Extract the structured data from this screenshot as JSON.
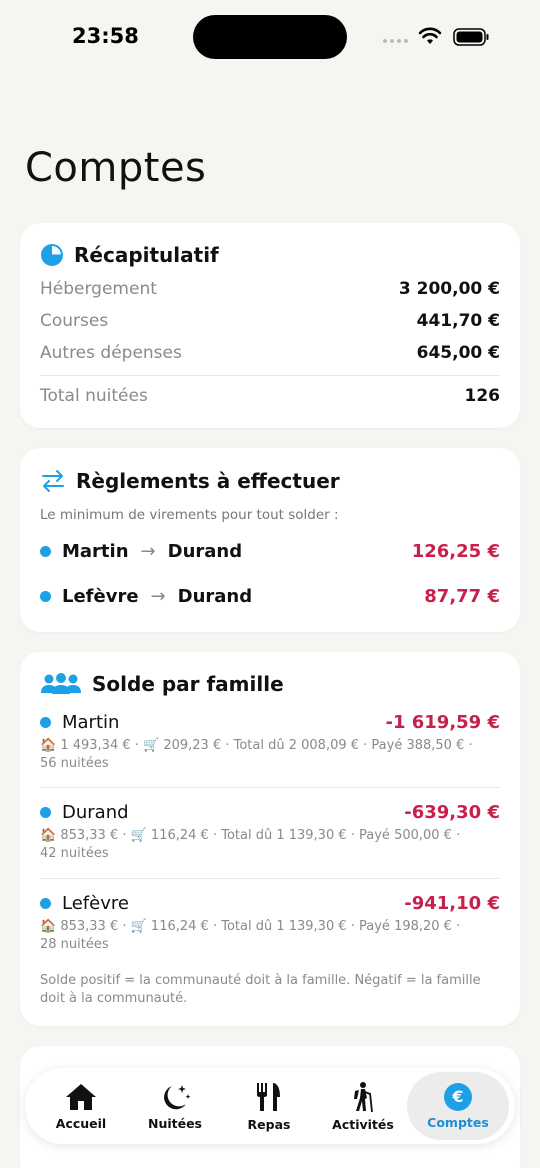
{
  "status": {
    "time": "23:58"
  },
  "page": {
    "title": "Comptes"
  },
  "recap": {
    "title": "Récapitulatif",
    "rows": [
      {
        "label": "Hébergement",
        "value": "3 200,00 €"
      },
      {
        "label": "Courses",
        "value": "441,70 €"
      },
      {
        "label": "Autres dépenses",
        "value": "645,00 €"
      }
    ],
    "total_label": "Total nuitées",
    "total_value": "126"
  },
  "settlements": {
    "title": "Règlements à effectuer",
    "hint": "Le minimum de virements pour tout solder :",
    "transfers": [
      {
        "from": "Martin",
        "to": "Durand",
        "amount": "126,25 €"
      },
      {
        "from": "Lefèvre",
        "to": "Durand",
        "amount": "87,77 €"
      }
    ]
  },
  "balances": {
    "title": "Solde par famille",
    "families": [
      {
        "name": "Martin",
        "amount": "-1 619,59 €",
        "detail_line1": "🏠 1 493,34 € · 🛒 209,23 € · Total dû 2 008,09 € · Payé 388,50 € ·",
        "detail_line2": "56 nuitées"
      },
      {
        "name": "Durand",
        "amount": "-639,30 €",
        "detail_line1": "🏠 853,33 € · 🛒 116,24 € · Total dû 1 139,30 € · Payé 500,00 € ·",
        "detail_line2": "42 nuitées"
      },
      {
        "name": "Lefèvre",
        "amount": "-941,10 €",
        "detail_line1": "🏠 853,33 € · 🛒 116,24 € · Total dû 1 139,30 € · Payé 198,20 € ·",
        "detail_line2": "28 nuitées"
      }
    ],
    "note": "Solde positif = la communauté doit à la famille. Négatif = la famille doit à la communauté."
  },
  "tabs": [
    {
      "label": "Accueil",
      "icon": "house-icon"
    },
    {
      "label": "Nuitées",
      "icon": "moon-stars-icon"
    },
    {
      "label": "Repas",
      "icon": "fork-knife-icon"
    },
    {
      "label": "Activités",
      "icon": "hiker-icon"
    },
    {
      "label": "Comptes",
      "icon": "euro-icon",
      "active": true
    }
  ],
  "colors": {
    "accent": "#1ea0e6",
    "negative": "#c8204a",
    "background": "#f6f5f2"
  }
}
